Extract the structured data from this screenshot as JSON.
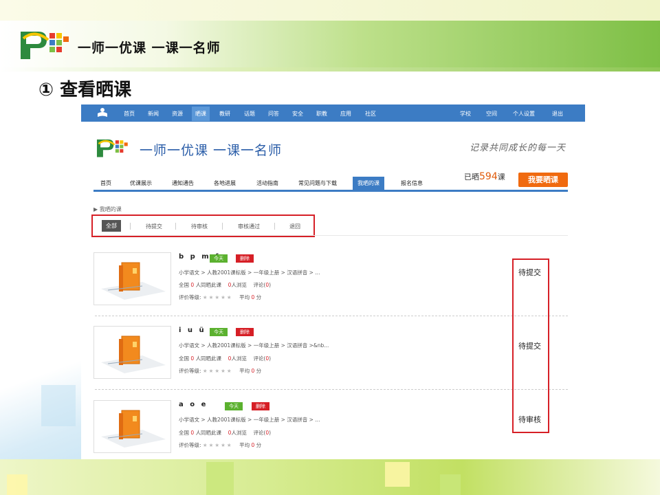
{
  "slide": {
    "logo_text": "一师一优课 一课一名师",
    "heading": "① 查看晒课"
  },
  "topnav": {
    "left_items": [
      "首页",
      "新闻",
      "资源",
      "晒课",
      "教研",
      "话题",
      "问答",
      "安全",
      "职教",
      "应用",
      "社区"
    ],
    "active": "晒课",
    "right_items": [
      "学校",
      "空间",
      "个人设置",
      "退出"
    ]
  },
  "site": {
    "logo_text": "一师一优课 一课一名师",
    "slogan": "记录共同成长的每一天"
  },
  "subnav": {
    "items": [
      "首页",
      "优课展示",
      "通知通告",
      "各地进展",
      "活动指南",
      "常见问题与下载",
      "我晒的课",
      "报名信息"
    ],
    "active": "我晒的课"
  },
  "stats": {
    "prefix": "已晒",
    "count": "594",
    "suffix": "课"
  },
  "share_button": "我要晒课",
  "breadcrumb": "▶ 我晒的课",
  "filters": {
    "items": [
      "全部",
      "待提交",
      "待审核",
      "审核通过",
      "退回"
    ],
    "active": "全部"
  },
  "courses": [
    {
      "title": "b p m f",
      "tag_today": "今天",
      "tag_delete": "删除",
      "path": "小学语文 > 人教2001课标版 > 一年级上册 > 汉语拼音    > ...",
      "p1": "全国",
      "n1": "0",
      "p2": "人同晒此课",
      "n2": "0",
      "p3": "人浏览",
      "p4": "评论(",
      "n3": "0",
      "p5": ")",
      "rating_label": "评价等级:",
      "stars": "★★★★★",
      "avg_label": "平均",
      "avg": "0",
      "avg_unit": "分",
      "status": "待提交"
    },
    {
      "title": "i u ü",
      "tag_today": "今天",
      "tag_delete": "删除",
      "path": "小学语文 > 人教2001课标版 > 一年级上册 > 汉语拼音    >&nb...",
      "p1": "全国",
      "n1": "0",
      "p2": "人同晒此课",
      "n2": "0",
      "p3": "人浏览",
      "p4": "评论(",
      "n3": "0",
      "p5": ")",
      "rating_label": "评价等级:",
      "stars": "★★★★★",
      "avg_label": "平均",
      "avg": "0",
      "avg_unit": "分",
      "status": "待提交"
    },
    {
      "title": "a o e",
      "tag_today": "今天",
      "tag_delete": "删除",
      "path": "小学语文 > 人教2001课标版 > 一年级上册 > 汉语拼音    > ...",
      "p1": "全国",
      "n1": "0",
      "p2": "人同晒此课",
      "n2": "0",
      "p3": "人浏览",
      "p4": "评论(",
      "n3": "0",
      "p5": ")",
      "rating_label": "评价等级:",
      "stars": "★★★★★",
      "avg_label": "平均",
      "avg": "0",
      "avg_unit": "分",
      "status": "待审核"
    }
  ],
  "colors": {
    "nav_blue": "#3c7cc4",
    "highlight_red": "#d61f26",
    "button_orange": "#f06a0f",
    "band_green": "#7dbf45"
  }
}
